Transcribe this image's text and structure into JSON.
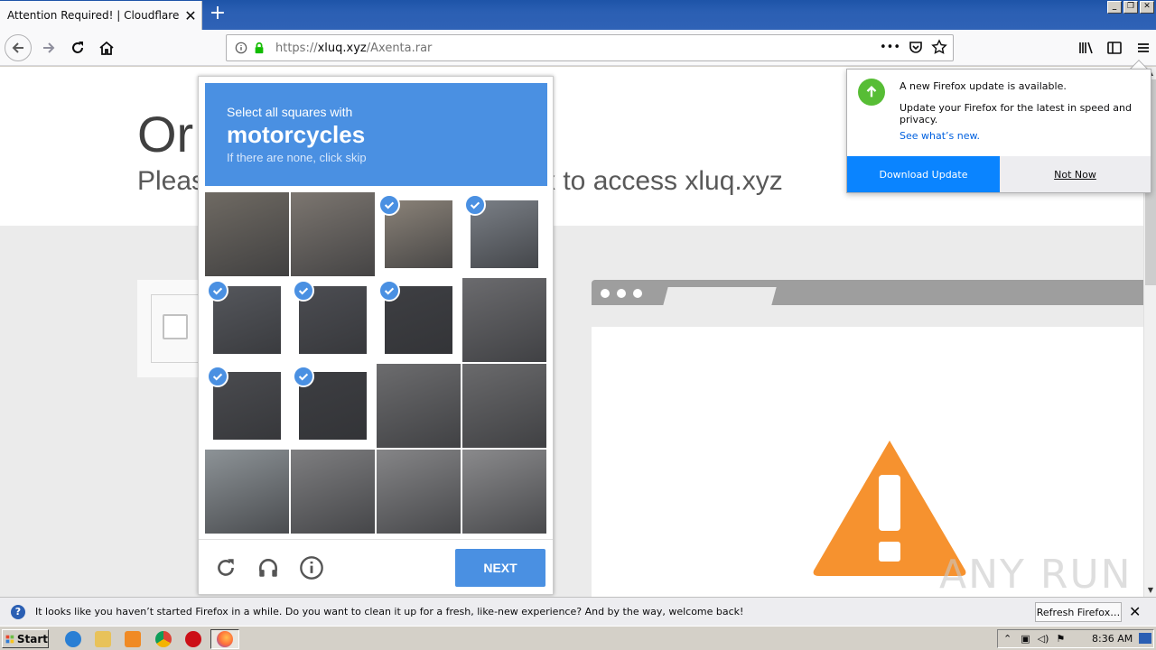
{
  "browser": {
    "tab": {
      "title": "Attention Required! | Cloudflare",
      "close": "✕"
    },
    "new_tab": "+",
    "url": {
      "prefix": "https://",
      "host": "xluq.xyz",
      "path": "/Axenta.rar"
    },
    "url_more": "•••"
  },
  "page": {
    "title": "Or",
    "subtitle": "Pleas",
    "subtitle_right": "x to access xluq.xyz",
    "watermark": "ANY RUN"
  },
  "captcha": {
    "instruction": "Select all squares with",
    "target": "motorcycles",
    "hint": "If there are none, click skip",
    "tiles": [
      {
        "selected": false,
        "color": "#6f6a63"
      },
      {
        "selected": false,
        "color": "#7c7670"
      },
      {
        "selected": true,
        "color": "#8a8278"
      },
      {
        "selected": true,
        "color": "#7a7f86"
      },
      {
        "selected": true,
        "color": "#55575c"
      },
      {
        "selected": true,
        "color": "#4c4d52"
      },
      {
        "selected": true,
        "color": "#3e3f43"
      },
      {
        "selected": false,
        "color": "#6b6b6e"
      },
      {
        "selected": true,
        "color": "#4a4b4f"
      },
      {
        "selected": true,
        "color": "#3d3e42"
      },
      {
        "selected": false,
        "color": "#6c6c6e"
      },
      {
        "selected": false,
        "color": "#6a6a6c"
      },
      {
        "selected": false,
        "color": "#8d9397"
      },
      {
        "selected": false,
        "color": "#7e7e80"
      },
      {
        "selected": false,
        "color": "#858587"
      },
      {
        "selected": false,
        "color": "#8a8a8c"
      }
    ],
    "next_label": "NEXT"
  },
  "update_popup": {
    "title": "A new Firefox update is available.",
    "description": "Update your Firefox for the latest in speed and privacy.",
    "link": "See what’s new.",
    "primary_button": "Download Update",
    "secondary_button": "Not Now"
  },
  "notification": {
    "text": "It looks like you haven’t started Firefox in a while. Do you want to clean it up for a fresh, like-new experience? And by the way, welcome back!",
    "button": "Refresh Firefox…",
    "close": "✕"
  },
  "taskbar": {
    "start_label": "Start",
    "time": "8:36 AM"
  },
  "colors": {
    "captcha_blue": "#4a90e2",
    "firefox_blue": "#0a84ff",
    "update_green": "#57bd35",
    "warning_orange": "#f6922f"
  }
}
